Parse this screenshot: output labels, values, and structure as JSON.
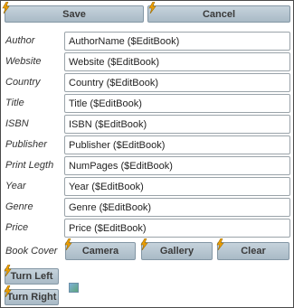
{
  "toolbar": {
    "save_label": "Save",
    "cancel_label": "Cancel"
  },
  "form": {
    "fields": [
      {
        "label": "Author",
        "value": "AuthorName ($EditBook)"
      },
      {
        "label": "Website",
        "value": "Website ($EditBook)"
      },
      {
        "label": "Country",
        "value": "Country ($EditBook)"
      },
      {
        "label": "Title",
        "value": "Title ($EditBook)"
      },
      {
        "label": "ISBN",
        "value": "ISBN ($EditBook)"
      },
      {
        "label": "Publisher",
        "value": "Publisher ($EditBook)"
      },
      {
        "label": "Print Legth",
        "value": "NumPages ($EditBook)"
      },
      {
        "label": "Year",
        "value": "Year ($EditBook)"
      },
      {
        "label": "Genre",
        "value": "Genre ($EditBook)"
      },
      {
        "label": "Price",
        "value": "Price ($EditBook)"
      }
    ],
    "book_cover_label": "Book Cover"
  },
  "cover_buttons": {
    "camera_label": "Camera",
    "gallery_label": "Gallery",
    "clear_label": "Clear"
  },
  "rotate": {
    "turn_left_label": "Turn Left",
    "turn_right_label": "Turn Right"
  },
  "icons": {
    "bolt": "lightning-bolt-icon",
    "cover": "cover-thumbnail-icon"
  },
  "colors": {
    "button_top": "#c6d3dc",
    "button_bottom": "#a9bac6",
    "bolt": "#f0a000"
  }
}
